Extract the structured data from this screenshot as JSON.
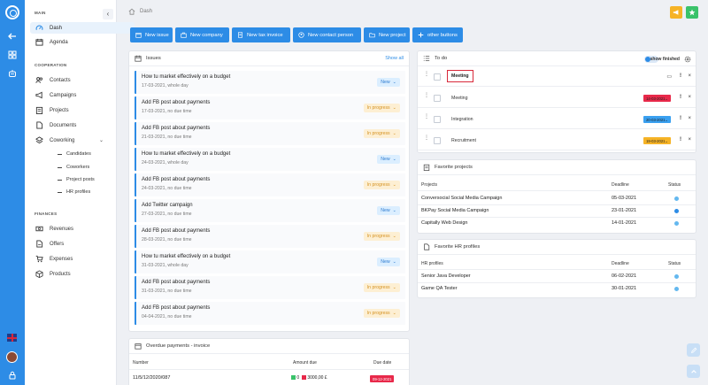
{
  "colors": {
    "brand": "#2d8ce6",
    "new": "#dbeeff",
    "in_progress": "#fdefd3",
    "red_date": "#e8294a",
    "blue_date": "#3aa0f0",
    "orange_date": "#f6b326"
  },
  "breadcrumb": {
    "label": "Dash"
  },
  "sidebar": {
    "main_title": "MAIN",
    "main_items": [
      {
        "label": "Dash"
      },
      {
        "label": "Agenda"
      }
    ],
    "coop_title": "COOPERATION",
    "coop_items": [
      {
        "label": "Contacts"
      },
      {
        "label": "Campaigns"
      },
      {
        "label": "Projects"
      },
      {
        "label": "Documents"
      },
      {
        "label": "Coworking"
      }
    ],
    "cowork_sub": [
      {
        "label": "Candidates"
      },
      {
        "label": "Coworkers"
      },
      {
        "label": "Project posts"
      },
      {
        "label": "HR profiles"
      }
    ],
    "fin_title": "FINANCES",
    "fin_items": [
      {
        "label": "Revenues"
      },
      {
        "label": "Offers"
      },
      {
        "label": "Expenses"
      },
      {
        "label": "Products"
      }
    ]
  },
  "actions": [
    {
      "label": "New issue"
    },
    {
      "label": "New company"
    },
    {
      "label": "New tax invoice"
    },
    {
      "label": "New contact person"
    },
    {
      "label": "New project"
    },
    {
      "label": "other buttons"
    }
  ],
  "issues": {
    "title": "Issues",
    "show_all": "Show all",
    "items": [
      {
        "title": "How tu market effectively on a budget",
        "date": "17-03-2021, whole day",
        "status": "New"
      },
      {
        "title": "Add FB post about payments",
        "date": "17-03-2021, no due time",
        "status": "In progress"
      },
      {
        "title": "Add FB post about payments",
        "date": "21-03-2021, no due time",
        "status": "In progress"
      },
      {
        "title": "How tu market effectively on a budget",
        "date": "24-03-2021, whole day",
        "status": "New"
      },
      {
        "title": "Add FB post about payments",
        "date": "24-03-2021, no due time",
        "status": "In progress"
      },
      {
        "title": "Add Twitter campaign",
        "date": "27-03-2021, no due time",
        "status": "New"
      },
      {
        "title": "Add FB post about payments",
        "date": "28-03-2021, no due time",
        "status": "In progress"
      },
      {
        "title": "How tu market effectively on a budget",
        "date": "31-03-2021, whole day",
        "status": "New"
      },
      {
        "title": "Add FB post about payments",
        "date": "31-03-2021, no due time",
        "status": "In progress"
      },
      {
        "title": "Add FB post about payments",
        "date": "04-04-2021, no due time",
        "status": "In progress"
      }
    ]
  },
  "overdue": {
    "title": "Overdue payments - invoice",
    "col_number": "Number",
    "col_amount": "Amount due",
    "col_due": "Due date",
    "row": {
      "number": "11/5/12/2020/087",
      "paid": "0",
      "amount": "3000,00 £",
      "due": "09-12-2021"
    }
  },
  "todo": {
    "title": "To do",
    "show_finished": "show finished",
    "items": [
      {
        "label": "Meeting",
        "due": "",
        "editing": true
      },
      {
        "label": "Meeting",
        "due": "14-03-2021",
        "due_color": "#e8294a"
      },
      {
        "label": "Integration",
        "due": "20-03-2021",
        "due_color": "#3aa0f0"
      },
      {
        "label": "Recruitment",
        "due": "19-03-2021",
        "due_color": "#f6b326"
      }
    ]
  },
  "fav_projects": {
    "title": "Favorite projects",
    "col_name": "Projects",
    "col_deadline": "Deadline",
    "col_status": "Status",
    "rows": [
      {
        "name": "Conversocial Social Media Campaign",
        "deadline": "05-03-2021",
        "status_color": "#64b8ef"
      },
      {
        "name": "BKPay Social Media Campaign",
        "deadline": "23-01-2021",
        "status_color": "#2d8ce6"
      },
      {
        "name": "Capitally Web Design",
        "deadline": "14-01-2021",
        "status_color": "#64b8ef"
      }
    ]
  },
  "fav_hr": {
    "title": "Favorite HR profiles",
    "col_name": "HR profiles",
    "col_deadline": "Deadline",
    "col_status": "Status",
    "rows": [
      {
        "name": "Senior Java Developer",
        "deadline": "06-02-2021",
        "status_color": "#64b8ef"
      },
      {
        "name": "Game QA Tester",
        "deadline": "30-01-2021",
        "status_color": "#64b8ef"
      }
    ]
  }
}
